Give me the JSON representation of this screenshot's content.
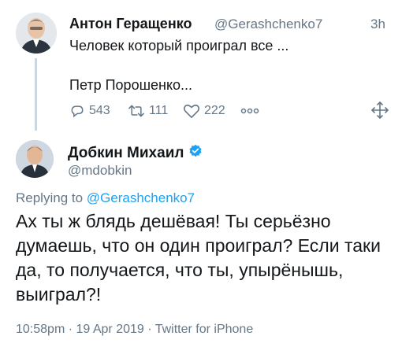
{
  "parent_tweet": {
    "author_name": "Антон Геращенко",
    "author_handle": "@Gerashchenko7",
    "time_ago": "3h",
    "text_line1": "Человек который проиграл все ...",
    "text_line2": "Петр Порошенко...",
    "reply_count": "543",
    "retweet_count": "111",
    "like_count": "222"
  },
  "reply_tweet": {
    "author_name": "Добкин Михаил",
    "author_handle": "@mdobkin",
    "verified": true,
    "replying_prefix": "Replying to",
    "replying_handle": "@Gerashchenko7",
    "text": "Ах ты ж блядь дешёвая! Ты серьёзно думаешь, что он один проиграл? Если таки да, то получается, что ты, упырёнышь, выиграл?!",
    "meta": "10:58pm · 19 Apr 2019 · Twitter for iPhone"
  },
  "icons": {
    "reply": "reply-icon",
    "retweet": "retweet-icon",
    "like": "heart-icon",
    "more": "more-dots-icon",
    "share": "share-move-icon",
    "verified": "verified-badge-icon"
  },
  "colors": {
    "text": "#14171a",
    "secondary": "#657786",
    "link": "#1da1f2",
    "thread_line": "#ccd6dd"
  }
}
